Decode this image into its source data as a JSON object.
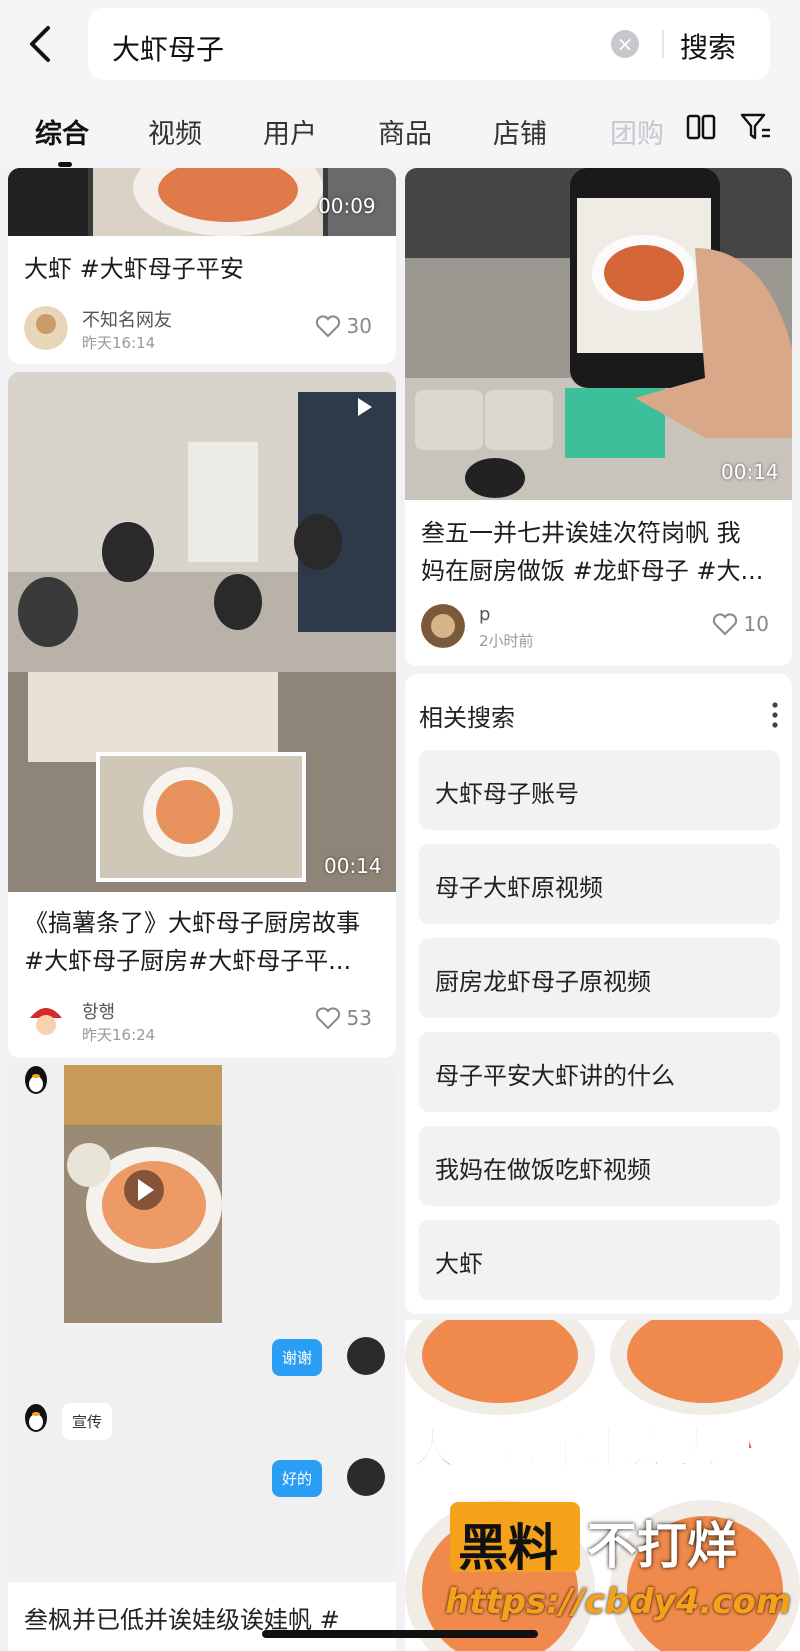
{
  "search": {
    "query": "大虾母子",
    "button_label": "搜索"
  },
  "tabs": [
    {
      "label": "综合",
      "active": true
    },
    {
      "label": "视频"
    },
    {
      "label": "用户"
    },
    {
      "label": "商品"
    },
    {
      "label": "店铺"
    },
    {
      "label": "团购"
    }
  ],
  "cards": [
    {
      "title": "大虾 #大虾母子平安",
      "duration": "00:09",
      "author": "不知名网友",
      "time": "昨天16:14",
      "likes": "30"
    },
    {
      "title_line1": "《搞薯条了》大虾母子厨房故事",
      "title_line2": "#大虾母子厨房#大虾母子平...",
      "duration": "00:14",
      "author": "항행",
      "time": "昨天16:24",
      "likes": "53"
    },
    {
      "title_line1": "叁五一并七井诶娃次符岗帆  我",
      "title_line2": "妈在厨房做饭 #龙虾母子 #大...",
      "duration": "00:14",
      "author": "p",
      "time": "2小时前",
      "likes": "10"
    }
  ],
  "related": {
    "title": "相关搜索",
    "items": [
      "大虾母子账号",
      "母子大虾原视频",
      "厨房龙虾母子原视频",
      "母子平安大虾讲的什么",
      "我妈在做饭吃虾视频",
      "大虾"
    ]
  },
  "chat": {
    "msg1": "谢谢",
    "msg2": "宣传",
    "msg3": "好的",
    "bottom_title": "叁枫并已低并诶娃级诶娃帆 #"
  },
  "ad": {
    "headline": "大虾母子来龙去脉",
    "watermark_left": "黑料",
    "watermark_right": "不打烊",
    "watermark_url": "https://cbdy4.com"
  },
  "colors": {
    "accent_blue": "#2a9ef4",
    "ad_red": "#e53b2a",
    "watermark_orange": "#f5a21a"
  }
}
